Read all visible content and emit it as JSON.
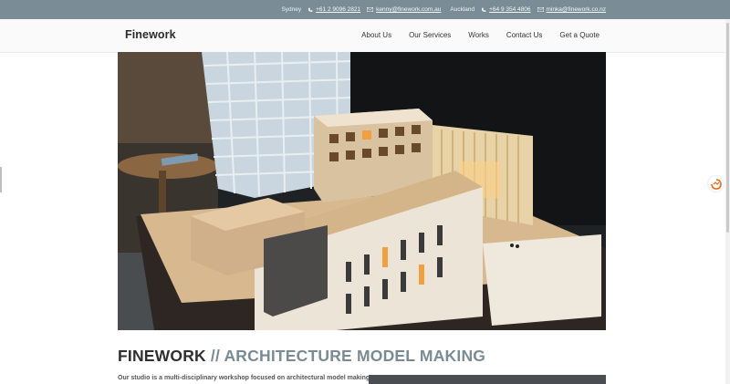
{
  "topbar": {
    "sydney": {
      "city": "Sydney",
      "phone": "+61 2 9096 2821",
      "email": "kenny@finework.com.au"
    },
    "auckland": {
      "city": "Auckland",
      "phone": "+64 9 354 4806",
      "email": "minka@finework.co.nz"
    },
    "phone_icon": "phone-icon",
    "email_icon": "envelope-icon",
    "bar_color": "#7a8d96"
  },
  "brand": "Finework",
  "nav": [
    {
      "label": "About Us"
    },
    {
      "label": "Our Services"
    },
    {
      "label": "Works"
    },
    {
      "label": "Contact Us"
    },
    {
      "label": "Get a Quote"
    }
  ],
  "hero": {
    "icon": "architecture-model-photo"
  },
  "heading": {
    "part1": "FINEWORK",
    "part2": " // ARCHITECTURE MODEL MAKING",
    "accent_color": "#7a8b93"
  },
  "intro_text": "Our studio is a multi-disciplinary workshop focused on architectural model making",
  "side_icon": "translate-icon"
}
